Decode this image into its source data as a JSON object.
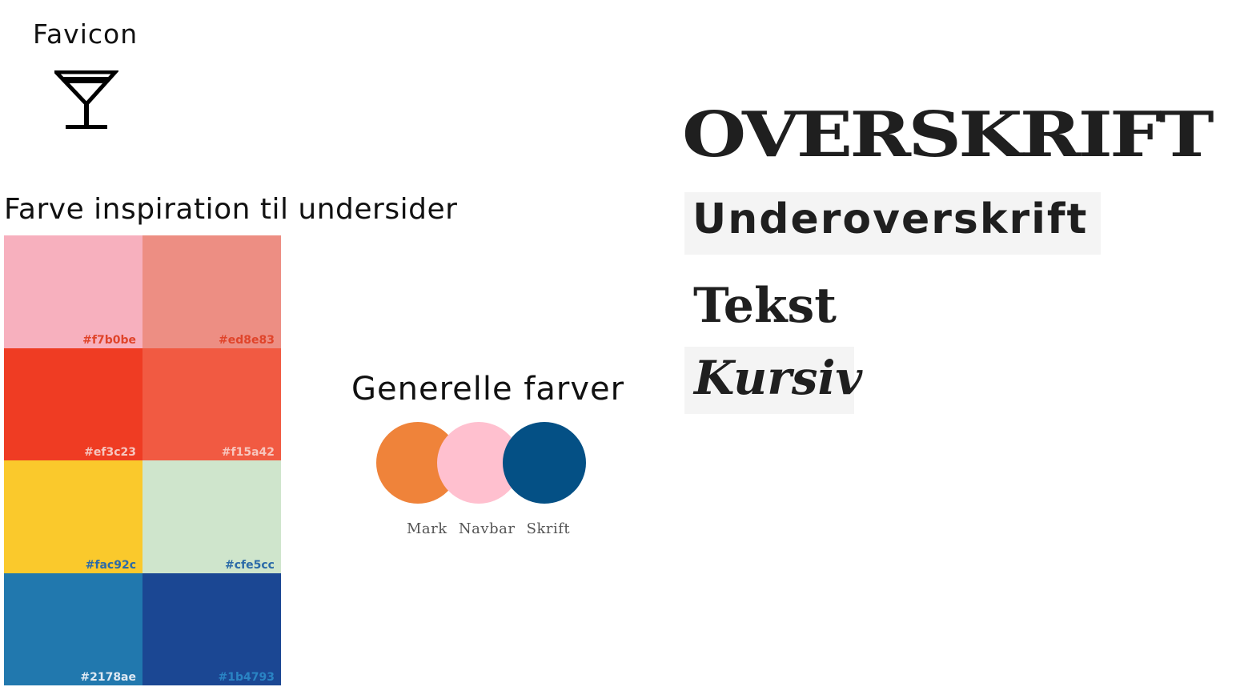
{
  "favicon": {
    "title": "Favicon",
    "icon": "martini-glass-icon"
  },
  "palette": {
    "title": "Farve inspiration til undersider",
    "swatches": [
      {
        "color": "#f7b0be",
        "label": "#f7b0be",
        "label_color": "#e0442a"
      },
      {
        "color": "#ed8e83",
        "label": "#ed8e83",
        "label_color": "#e0442a"
      },
      {
        "color": "#ef3c23",
        "label": "#ef3c23",
        "label_color": "#f6c6c0"
      },
      {
        "color": "#f15a42",
        "label": "#f15a42",
        "label_color": "#f7c6be"
      },
      {
        "color": "#fac92c",
        "label": "#fac92c",
        "label_color": "#2b6aa8"
      },
      {
        "color": "#cfe5cc",
        "label": "#cfe5cc",
        "label_color": "#2b6aa8"
      },
      {
        "color": "#2178ae",
        "label": "#2178ae",
        "label_color": "#dfe9f3"
      },
      {
        "color": "#1b4793",
        "label": "#1b4793",
        "label_color": "#2a84c4"
      }
    ]
  },
  "general_colors": {
    "title": "Generelle farver",
    "items": [
      {
        "label": "Mark",
        "color": "#ef833a"
      },
      {
        "label": "Navbar",
        "color": "#ffc0cf"
      },
      {
        "label": "Skrift",
        "color": "#045085"
      }
    ]
  },
  "typography": {
    "heading": "OVERSKRIFT",
    "subheading": "Underoverskrift",
    "text": "Tekst",
    "italic": "Kursiv"
  }
}
